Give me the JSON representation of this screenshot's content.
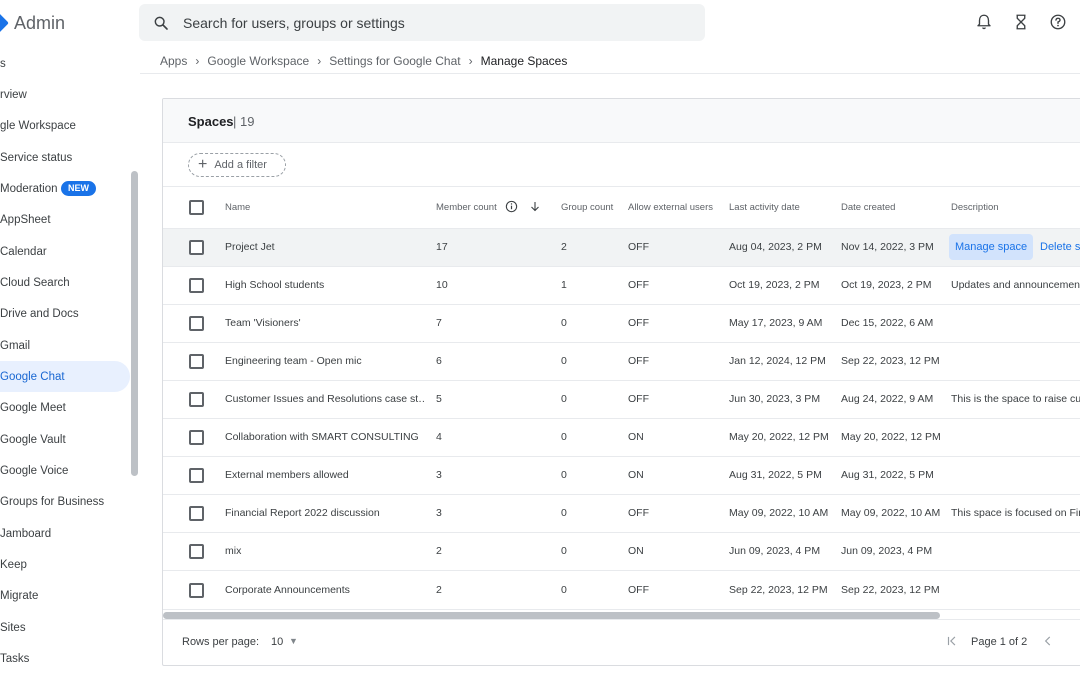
{
  "app": {
    "title": "Admin"
  },
  "search": {
    "placeholder": "Search for users, groups or settings"
  },
  "header_icons": [
    "bell-icon",
    "hourglass-icon",
    "help-icon"
  ],
  "breadcrumb": [
    "Apps",
    "Google Workspace",
    "Settings for Google Chat",
    "Manage Spaces"
  ],
  "sidebar": {
    "items": [
      {
        "label": "s"
      },
      {
        "label": "rview"
      },
      {
        "label": "gle Workspace"
      },
      {
        "label": "Service status"
      },
      {
        "label": "Moderation",
        "badge": "NEW"
      },
      {
        "label": "AppSheet"
      },
      {
        "label": "Calendar"
      },
      {
        "label": "Cloud Search"
      },
      {
        "label": "Drive and Docs"
      },
      {
        "label": "Gmail"
      },
      {
        "label": "Google Chat",
        "active": true
      },
      {
        "label": "Google Meet"
      },
      {
        "label": "Google Vault"
      },
      {
        "label": "Google Voice"
      },
      {
        "label": "Groups for Business"
      },
      {
        "label": "Jamboard"
      },
      {
        "label": "Keep"
      },
      {
        "label": "Migrate"
      },
      {
        "label": "Sites"
      },
      {
        "label": "Tasks"
      }
    ]
  },
  "panel": {
    "title": "Spaces",
    "count": "| 19",
    "filter_label": "Add a filter",
    "columns": {
      "name": "Name",
      "member_count": "Member count",
      "group_count": "Group count",
      "allow_external": "Allow external users",
      "last_activity": "Last activity date",
      "date_created": "Date created",
      "description": "Description"
    },
    "row_actions": {
      "manage": "Manage space",
      "delete": "Delete s"
    },
    "rows": [
      {
        "name": "Project Jet",
        "members": "17",
        "groups": "2",
        "external": "OFF",
        "last_activity": "Aug 04, 2023, 2 PM",
        "created": "Nov 14, 2022, 3 PM",
        "description": ""
      },
      {
        "name": "High School students",
        "members": "10",
        "groups": "1",
        "external": "OFF",
        "last_activity": "Oct 19, 2023, 2 PM",
        "created": "Oct 19, 2023, 2 PM",
        "description": "Updates and announcements"
      },
      {
        "name": "Team 'Visioners'",
        "members": "7",
        "groups": "0",
        "external": "OFF",
        "last_activity": "May 17, 2023, 9 AM",
        "created": "Dec 15, 2022, 6 AM",
        "description": ""
      },
      {
        "name": "Engineering team - Open mic",
        "members": "6",
        "groups": "0",
        "external": "OFF",
        "last_activity": "Jan 12, 2024, 12 PM",
        "created": "Sep 22, 2023, 12 PM",
        "description": ""
      },
      {
        "name": "Customer Issues and Resolutions case st…",
        "members": "5",
        "groups": "0",
        "external": "OFF",
        "last_activity": "Jun 30, 2023, 3 PM",
        "created": "Aug 24, 2022, 9 AM",
        "description": "This is the space to raise cus"
      },
      {
        "name": "Collaboration with SMART CONSULTING",
        "members": "4",
        "groups": "0",
        "external": "ON",
        "last_activity": "May 20, 2022, 12 PM",
        "created": "May 20, 2022, 12 PM",
        "description": ""
      },
      {
        "name": "External members allowed",
        "members": "3",
        "groups": "0",
        "external": "ON",
        "last_activity": "Aug 31, 2022, 5 PM",
        "created": "Aug 31, 2022, 5 PM",
        "description": ""
      },
      {
        "name": "Financial Report 2022 discussion",
        "members": "3",
        "groups": "0",
        "external": "OFF",
        "last_activity": "May 09, 2022, 10 AM",
        "created": "May 09, 2022, 10 AM",
        "description": "This space is focused on Fin"
      },
      {
        "name": "mix",
        "members": "2",
        "groups": "0",
        "external": "ON",
        "last_activity": "Jun 09, 2023, 4 PM",
        "created": "Jun 09, 2023, 4 PM",
        "description": ""
      },
      {
        "name": "Corporate Announcements",
        "members": "2",
        "groups": "0",
        "external": "OFF",
        "last_activity": "Sep 22, 2023, 12 PM",
        "created": "Sep 22, 2023, 12 PM",
        "description": ""
      }
    ],
    "footer": {
      "rows_per_page_label": "Rows per page:",
      "rows_per_page_value": "10",
      "page_label": "Page 1 of 2"
    }
  },
  "colors": {
    "accent": "#1a73e8",
    "active_bg": "#e8f0fe",
    "hover_row": "#f1f3f4"
  }
}
